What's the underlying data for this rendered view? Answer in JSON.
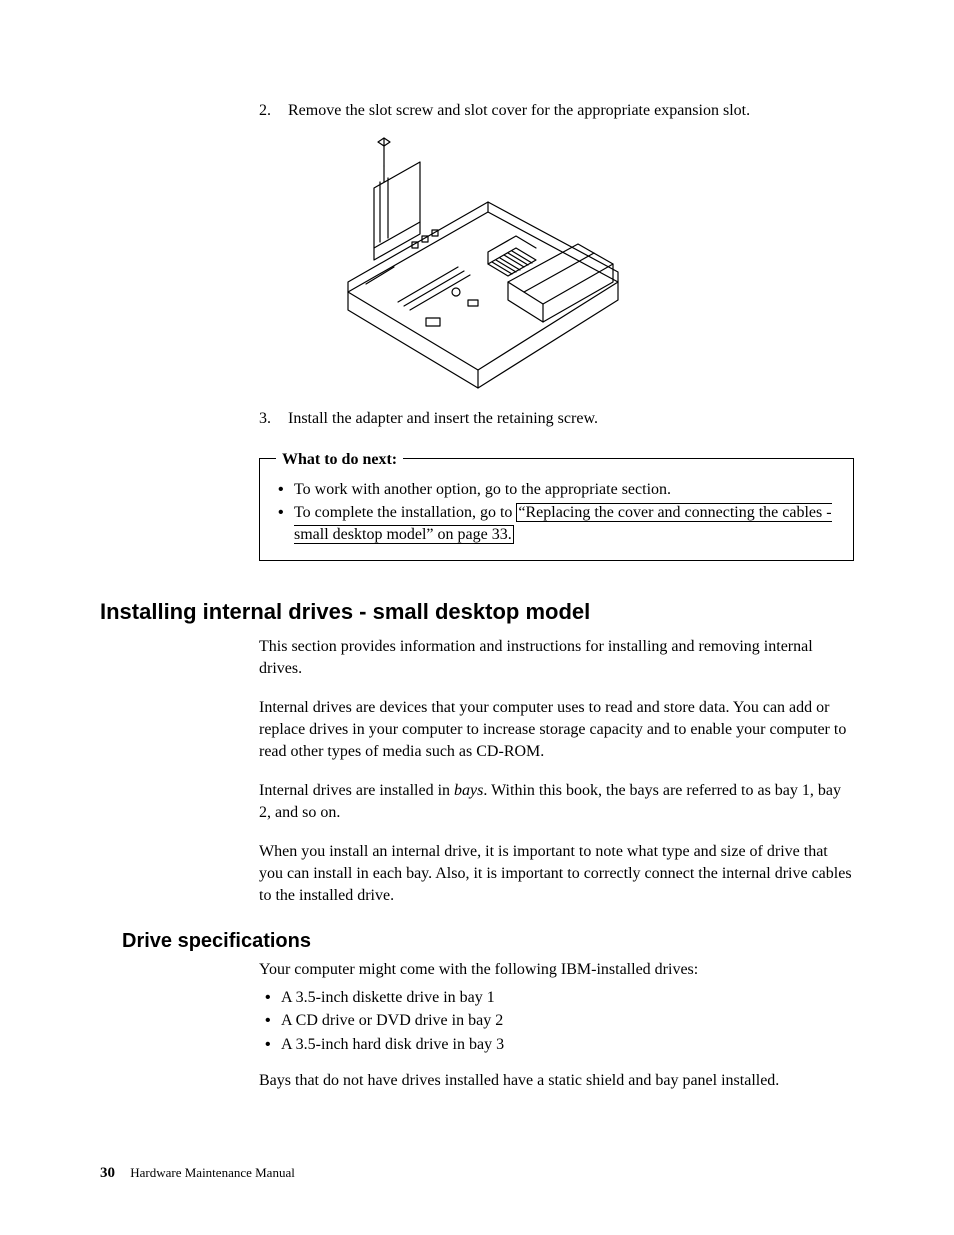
{
  "steps": {
    "s2_num": "2",
    "s2_text": "Remove the slot screw and slot cover for the appropriate expansion slot.",
    "s3_num": "3",
    "s3_text": "Install the adapter and insert the retaining screw."
  },
  "callout": {
    "legend": "What to do next:",
    "item1": "To work with another option, go to the appropriate section.",
    "item2_pre": "To complete the installation, go to ",
    "item2_link": "“Replacing the cover and connecting the cables - small desktop model” on page 33."
  },
  "h1": "Installing internal drives - small desktop model",
  "p1": "This section provides information and instructions for installing and removing internal drives.",
  "p2": "Internal drives are devices that your computer uses to read and store data. You can add or replace drives in your computer to increase storage capacity and to enable your computer to read other types of media such as CD-ROM.",
  "p3_pre": "Internal drives are installed in ",
  "p3_em": "bays",
  "p3_post": ". Within this book, the bays are referred to as bay 1, bay 2, and so on.",
  "p4": "When you install an internal drive, it is important to note what type and size of drive that you can install in each bay. Also, it is important to correctly connect the internal drive cables to the installed drive.",
  "h2": "Drive specifications",
  "spec_intro": "Your computer might come with the following IBM-installed drives:",
  "spec_b1": "A 3.5-inch diskette drive in bay 1",
  "spec_b2": "A CD drive or DVD drive in bay 2",
  "spec_b3": "A 3.5-inch hard disk drive in bay 3",
  "spec_outro": "Bays that do not have drives installed have a static shield and bay panel installed.",
  "footer": {
    "page": "30",
    "title": "Hardware Maintenance Manual"
  }
}
